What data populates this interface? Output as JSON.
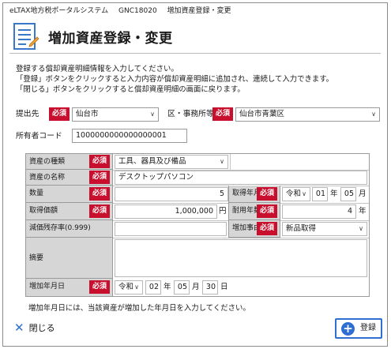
{
  "titlebar": {
    "system": "eLTAX地方税ポータルシステム",
    "code": "GNC18020",
    "screen": "増加資産登録・変更"
  },
  "header": {
    "title": "増加資産登録・変更",
    "icon": "document-icon"
  },
  "description": [
    "登録する償却資産明細情報を入力してください。",
    "「登録」ボタンをクリックすると入力内容が償却資産明細に追加され、連続して入力できます。",
    "「閉じる」ボタンをクリックすると償却資産明細の画面に戻ります。"
  ],
  "required_label": "必須",
  "submit_to": {
    "label": "提出先",
    "value": "仙台市"
  },
  "office": {
    "label": "区・事務所等",
    "value": "仙台市青葉区"
  },
  "owner_code": {
    "label": "所有者コード",
    "value": "1000000000000000001"
  },
  "asset": {
    "type": {
      "label": "資産の種類",
      "value": "工具、器具及び備品"
    },
    "name": {
      "label": "資産の名称",
      "value": "デスクトップパソコン"
    },
    "quantity": {
      "label": "数量",
      "value": "5"
    },
    "acquired": {
      "label": "取得年月",
      "era": "令和",
      "year": "01",
      "year_unit": "年",
      "month": "05",
      "month_unit": "月"
    },
    "price": {
      "label": "取得価額",
      "value": "1,000,000",
      "unit": "円"
    },
    "useful_life": {
      "label": "耐用年数",
      "value": "4",
      "unit": "年"
    },
    "residual_rate": {
      "label": "減価残存率(0.999)",
      "value": ""
    },
    "reason": {
      "label": "増加事由",
      "value": "新品取得"
    },
    "remarks": {
      "label": "摘要",
      "value": ""
    },
    "increase_date": {
      "label": "増加年月日",
      "era": "令和",
      "year": "02",
      "year_unit": "年",
      "month": "05",
      "month_unit": "月",
      "day": "30",
      "day_unit": "日"
    }
  },
  "note": "増加年月日には、当該資産が増加した年月日を入力してください。",
  "buttons": {
    "close": "閉じる",
    "register": "登録"
  }
}
